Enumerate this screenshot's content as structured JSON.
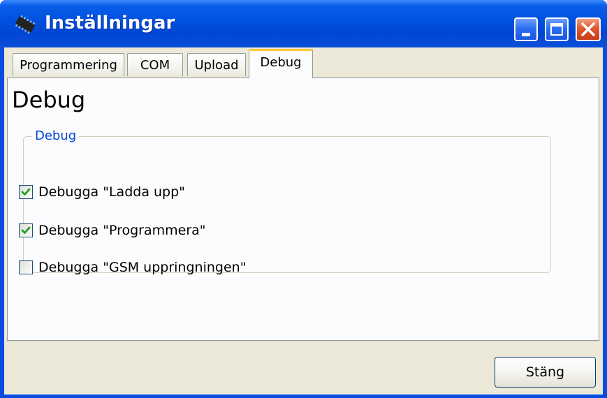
{
  "window": {
    "title": "Inställningar",
    "icon": "chip-icon",
    "controls": {
      "minimize": "minimize-icon",
      "maximize": "maximize-icon",
      "close": "close-icon"
    }
  },
  "tabs": [
    {
      "label": "Programmering",
      "active": false
    },
    {
      "label": "COM",
      "active": false
    },
    {
      "label": "Upload",
      "active": false
    },
    {
      "label": "Debug",
      "active": true
    }
  ],
  "panel": {
    "title": "Debug",
    "group": {
      "label": "Debug",
      "options": [
        {
          "label": "Debugga \"Ladda upp\"",
          "checked": true
        },
        {
          "label": "Debugga \"Programmera\"",
          "checked": true
        },
        {
          "label": "Debugga \"GSM uppringningen\"",
          "checked": false
        }
      ]
    }
  },
  "footer": {
    "close_label": "Stäng"
  },
  "colors": {
    "titlebar": "#0052e0",
    "group_label": "#0046d5",
    "check_mark": "#21a121",
    "active_tab_accent": "#ffc83c"
  }
}
